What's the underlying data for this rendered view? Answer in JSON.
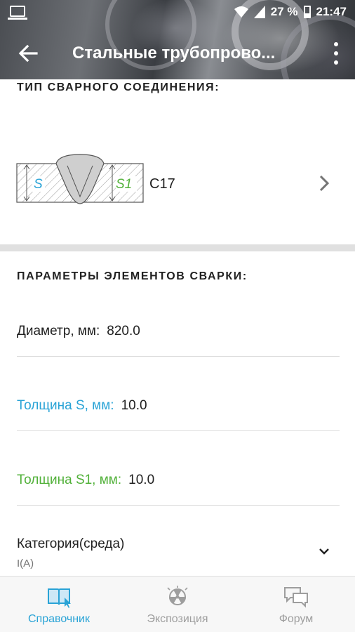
{
  "status_bar": {
    "battery": "27 %",
    "time": "21:47"
  },
  "toolbar": {
    "title": "Стальные трубопрово..."
  },
  "weld_section": {
    "title": "ТИП СВАРНОГО СОЕДИНЕНИЯ:",
    "code": "С17",
    "label_s": "S",
    "label_s1": "S1"
  },
  "params_section": {
    "title": "ПАРАМЕТРЫ ЭЛЕМЕНТОВ СВАРКИ:",
    "diameter_label": "Диаметр, мм:",
    "diameter_value": "820.0",
    "thickness_s_label": "Толщина S, мм:",
    "thickness_s_value": "10.0",
    "thickness_s1_label": "Толщина S1, мм:",
    "thickness_s1_value": "10.0",
    "category_label": "Категория(среда)",
    "category_value": "I(A)"
  },
  "bottom_nav": {
    "items": [
      {
        "label": "Справочник",
        "active": true
      },
      {
        "label": "Экспозиция",
        "active": false
      },
      {
        "label": "Форум",
        "active": false
      }
    ]
  },
  "colors": {
    "accent_blue": "#29a3d6",
    "accent_green": "#52b13a",
    "inactive_gray": "#9e9e9e"
  }
}
